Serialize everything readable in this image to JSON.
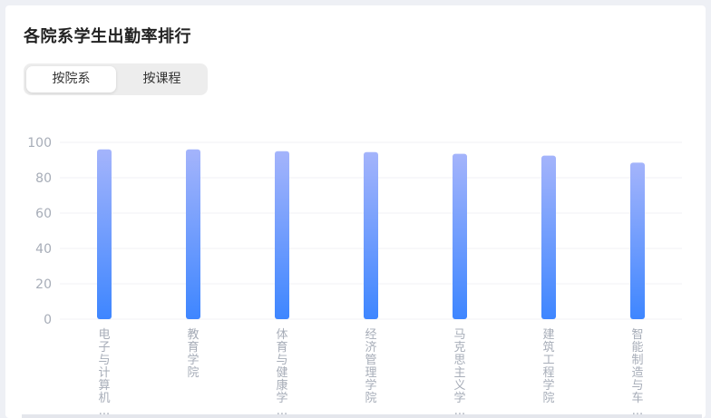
{
  "title": "各院系学生出勤率排行",
  "tabs": [
    {
      "label": "按院系",
      "active": true
    },
    {
      "label": "按课程",
      "active": false
    }
  ],
  "colors": {
    "bar_top": "#a4b4fb",
    "bar_bottom": "#3e86ff",
    "axis_text": "#a7adb8",
    "grid": "#f0f1f4"
  },
  "chart_data": {
    "type": "bar",
    "categories": [
      "电子与计算机…",
      "教育学院",
      "体育与健康学…",
      "经济管理学院",
      "马克思主义学…",
      "建筑工程学院",
      "智能制造与车…"
    ],
    "series": [
      {
        "values": [
          96,
          96,
          95,
          94.5,
          93.5,
          92.5,
          88.5
        ]
      }
    ],
    "ylim": [
      0,
      100
    ],
    "yticks": [
      0,
      20,
      40,
      60,
      80,
      100
    ],
    "ylabel": "",
    "xlabel": "",
    "grid": true,
    "legend": "none"
  }
}
